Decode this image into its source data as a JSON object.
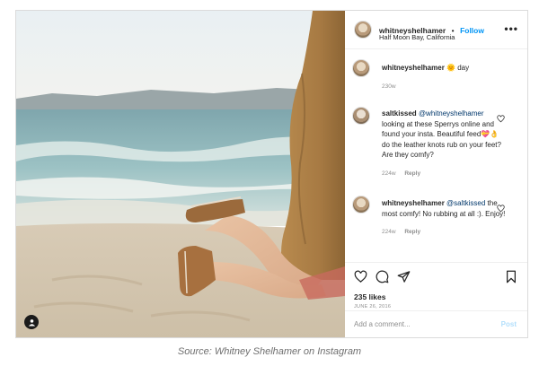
{
  "post": {
    "owner": {
      "username": "whitneyshelhamer",
      "separator": "•",
      "follow_label": "Follow",
      "location": "Half Moon Bay, California"
    },
    "more_label": "•••",
    "comments": [
      {
        "username": "whitneyshelhamer",
        "text": "🌞 day",
        "age": "230w",
        "reply_label": ""
      },
      {
        "username": "saltkissed",
        "mention": "@whitneyshelhamer",
        "text": "looking at these Sperrys online and found your insta. Beautiful feed💝👌 do the leather knots rub on your feet? Are they comfy?",
        "age": "224w",
        "reply_label": "Reply"
      },
      {
        "username": "whitneyshelhamer",
        "mention": "@saltkissed",
        "text": "the most comfy! No rubbing at all :). Enjoy!",
        "age": "224w",
        "reply_label": "Reply"
      }
    ],
    "likes": "235 likes",
    "date": "JUNE 26, 2016",
    "add_comment_placeholder": "Add a comment...",
    "post_button_label": "Post"
  },
  "caption": "Source: Whitney Shelhamer on Instagram",
  "colors": {
    "link_blue": "#0095f6",
    "post_disabled": "#b2dffc",
    "muted": "#8e8e8e"
  },
  "icons": [
    "user-tag-icon",
    "more-icon",
    "heart-icon",
    "comment-icon",
    "share-icon",
    "bookmark-icon",
    "comment-like-icon"
  ]
}
